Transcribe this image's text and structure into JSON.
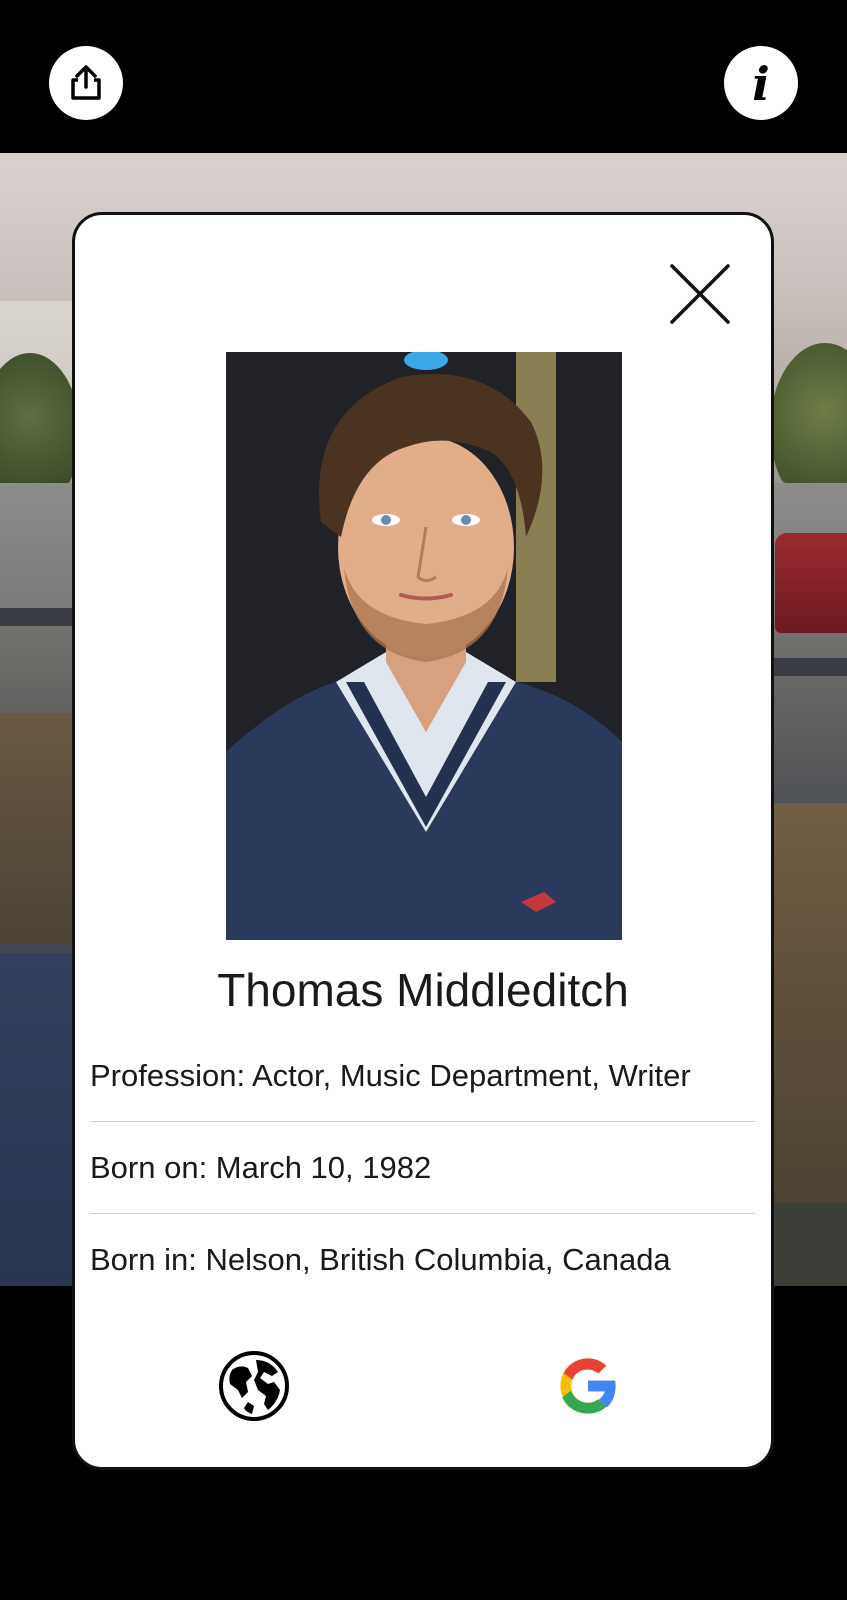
{
  "top_bar": {
    "share_icon": "share-icon",
    "info_icon": "info-icon",
    "info_glyph": "i"
  },
  "card": {
    "close_icon": "close-icon",
    "person": {
      "name": "Thomas Middleditch",
      "photo": "portrait-photo"
    },
    "details": [
      {
        "text": "Profession: Actor, Music Department, Writer"
      },
      {
        "text": "Born on: March 10, 1982"
      },
      {
        "text": "Born in: Nelson, British Columbia, Canada"
      }
    ],
    "actions": [
      {
        "icon": "globe-icon"
      },
      {
        "icon": "google-icon"
      }
    ]
  },
  "colors": {
    "card_bg": "#ffffff",
    "text": "#1a1a1a",
    "divider": "#cfcfcf",
    "google_blue": "#4285F4",
    "google_red": "#EA4335",
    "google_yellow": "#FBBC05",
    "google_green": "#34A853"
  }
}
